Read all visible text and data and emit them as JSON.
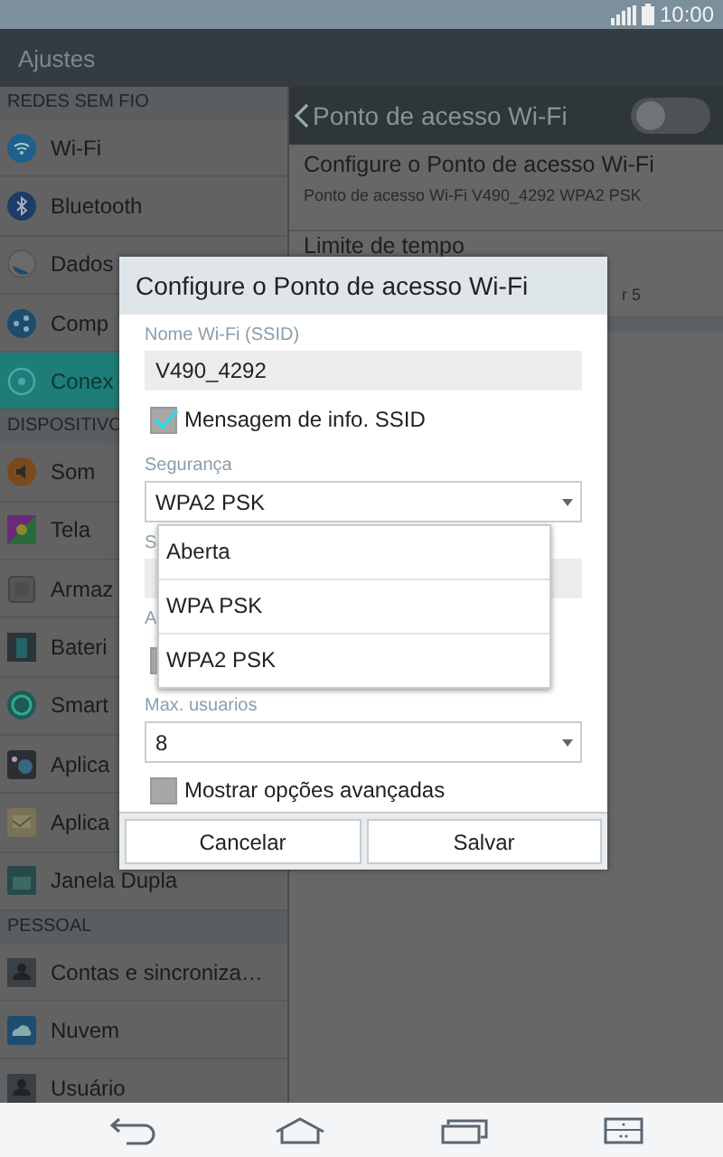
{
  "status_bar": {
    "time": "10:00"
  },
  "app_bar": {
    "title": "Ajustes"
  },
  "sidebar": {
    "sections": [
      {
        "header": "REDES SEM FIO",
        "items": [
          {
            "label": "Wi-Fi",
            "selected": false
          },
          {
            "label": "Bluetooth",
            "selected": false
          },
          {
            "label": "Dados",
            "selected": false
          },
          {
            "label": "Comp",
            "selected": false
          },
          {
            "label": "Conex",
            "selected": true
          }
        ]
      },
      {
        "header": "DISPOSITIVO",
        "items": [
          {
            "label": "Som",
            "selected": false
          },
          {
            "label": "Tela",
            "selected": false
          },
          {
            "label": "Armaz",
            "selected": false
          },
          {
            "label": "Bateri",
            "selected": false
          },
          {
            "label": "Smart",
            "selected": false
          },
          {
            "label": "Aplica",
            "selected": false
          },
          {
            "label": "Aplica",
            "selected": false
          },
          {
            "label": "Janela Dupla",
            "selected": false
          }
        ]
      },
      {
        "header": "PESSOAL",
        "items": [
          {
            "label": "Contas e sincroniza…",
            "selected": false
          },
          {
            "label": "Nuvem",
            "selected": false
          },
          {
            "label": "Usuário",
            "selected": false
          }
        ]
      }
    ]
  },
  "detail": {
    "title": "Ponto de acesso Wi-Fi",
    "toggle_on": false,
    "rows": [
      {
        "title": "Configure o Ponto de acesso Wi-Fi",
        "subtitle": "Ponto de acesso Wi-Fi V490_4292 WPA2 PSK"
      },
      {
        "title": "Limite de tempo",
        "subtitle": "r 5"
      }
    ]
  },
  "dialog": {
    "title": "Configure o Ponto de acesso Wi-Fi",
    "rows": [
      {
        "kind": "text_field",
        "label": "Nome Wi-Fi (SSID)",
        "value": "V490_4292"
      },
      {
        "kind": "checkbox",
        "label": "Mensagem de info. SSID",
        "checked": true
      },
      {
        "kind": "select",
        "label": "Segurança",
        "value": "WPA2 PSK"
      },
      {
        "kind": "text_field",
        "label": "S"
      },
      {
        "kind": "checkbox_group",
        "label": "A"
      },
      {
        "kind": "select",
        "label": "Max. usuarios",
        "value": "8"
      },
      {
        "kind": "checkbox",
        "label": "Mostrar opções avançadas",
        "checked": false
      }
    ],
    "dropdown": {
      "options": [
        "Aberta",
        "WPA PSK",
        "WPA2 PSK"
      ]
    },
    "buttons": [
      "Cancelar",
      "Salvar"
    ]
  }
}
